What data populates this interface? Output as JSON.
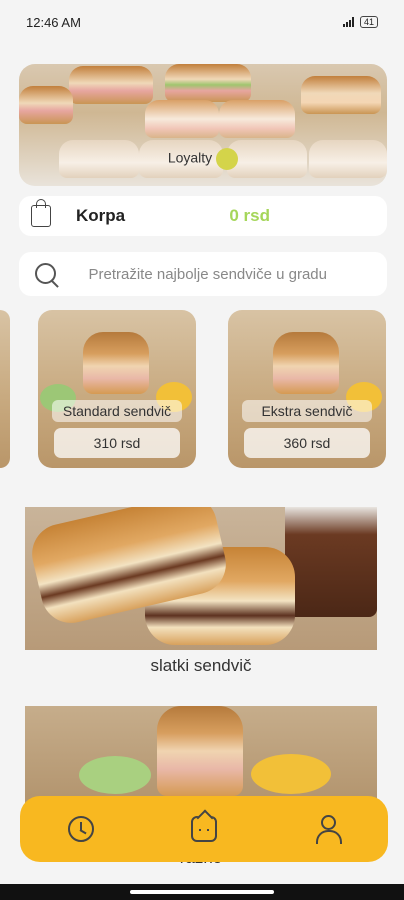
{
  "status_bar": {
    "time": "12:46 AM",
    "battery": "41"
  },
  "hero": {
    "label": "Loyalty"
  },
  "cart": {
    "label": "Korpa",
    "total": "0 rsd"
  },
  "search": {
    "placeholder": "Pretražite najbolje sendviče u gradu"
  },
  "products": [
    {
      "name": "Standard sendvič",
      "price": "310 rsd"
    },
    {
      "name": "Ekstra sendvič",
      "price": "360 rsd"
    }
  ],
  "categories": [
    {
      "label": "slatki sendvič"
    },
    {
      "label": "razno"
    }
  ],
  "nav": {
    "items": [
      {
        "icon": "clock-icon"
      },
      {
        "icon": "home-icon"
      },
      {
        "icon": "user-icon"
      }
    ]
  },
  "colors": {
    "accent": "#f8b820",
    "price_green": "#a5d65a",
    "background": "#f4f4f4"
  }
}
